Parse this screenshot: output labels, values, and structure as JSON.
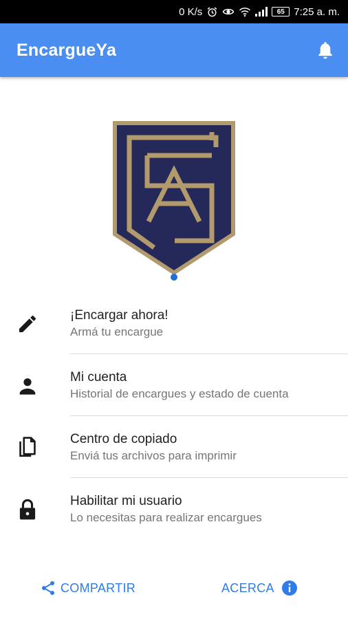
{
  "status_bar": {
    "network_speed": "0 K/s",
    "battery_level": "65",
    "time": "7:25 a. m."
  },
  "app_bar": {
    "title": "EncargueYa",
    "icon": "bell-icon"
  },
  "colors": {
    "primary": "#4a8ef2",
    "accent_text": "#2f7be9",
    "logo_navy": "#24295a",
    "logo_gold": "#b39a6c"
  },
  "menu": {
    "items": [
      {
        "icon": "pencil-icon",
        "title": "¡Encargar ahora!",
        "subtitle": "Armá tu encargue"
      },
      {
        "icon": "person-icon",
        "title": "Mi cuenta",
        "subtitle": "Historial de encargues y estado de cuenta"
      },
      {
        "icon": "documents-icon",
        "title": "Centro de copiado",
        "subtitle": "Enviá tus archivos para imprimir"
      },
      {
        "icon": "lock-icon",
        "title": "Habilitar mi usuario",
        "subtitle": "Lo necesitas para realizar encargues"
      }
    ]
  },
  "footer": {
    "share_label": "COMPARTIR",
    "about_label": "ACERCA"
  }
}
